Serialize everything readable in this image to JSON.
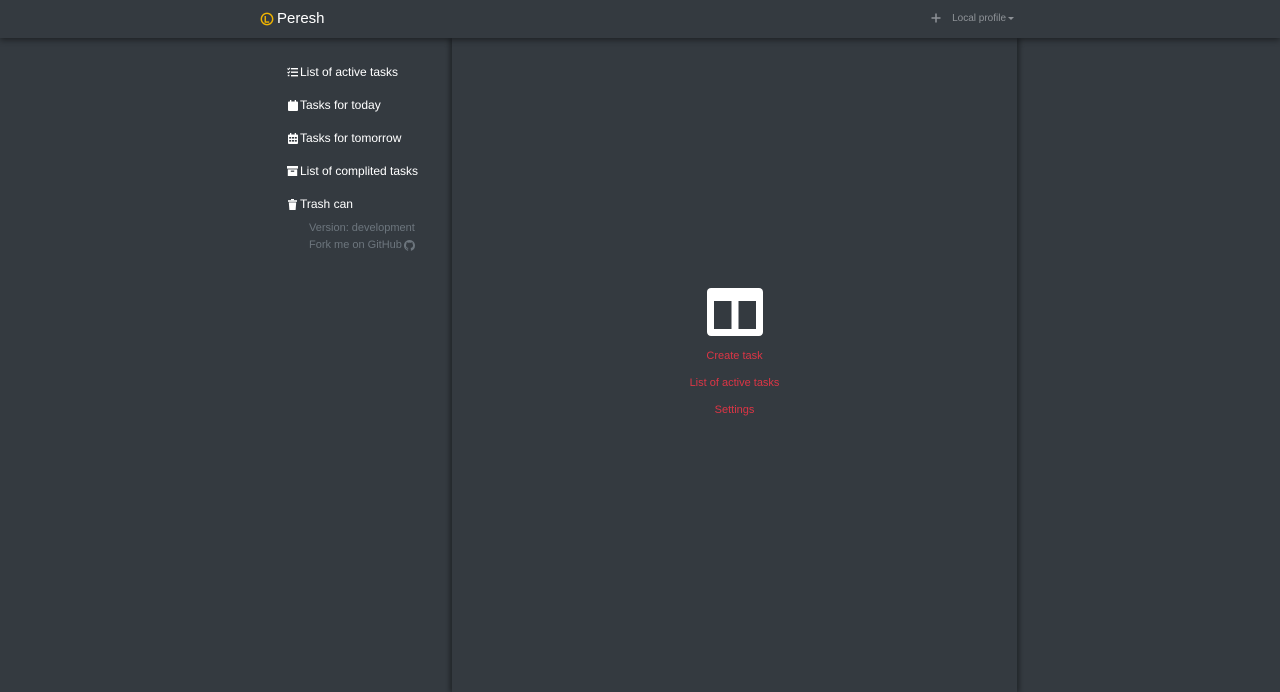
{
  "navbar": {
    "brand": "Peresh",
    "brand_icon": "peresh-logo-icon",
    "add_icon": "plus-icon",
    "profile_label": "Local profile"
  },
  "sidebar": {
    "items": [
      {
        "label": "List of active tasks",
        "icon": "list-check-icon"
      },
      {
        "label": "Tasks for today",
        "icon": "calendar-icon"
      },
      {
        "label": "Tasks for tomorrow",
        "icon": "calendar-grid-icon"
      },
      {
        "label": "List of complited tasks",
        "icon": "archive-icon"
      },
      {
        "label": "Trash can",
        "icon": "trash-icon"
      }
    ],
    "version": "Version: development",
    "github_link": "Fork me on GitHub"
  },
  "main": {
    "empty_icon": "columns-icon",
    "links": [
      "Create task",
      "List of active tasks",
      "Settings"
    ]
  },
  "colors": {
    "background": "#343a40",
    "accent_link": "#dc3545",
    "brand_logo": "#f0b400",
    "muted": "#6c757d"
  }
}
